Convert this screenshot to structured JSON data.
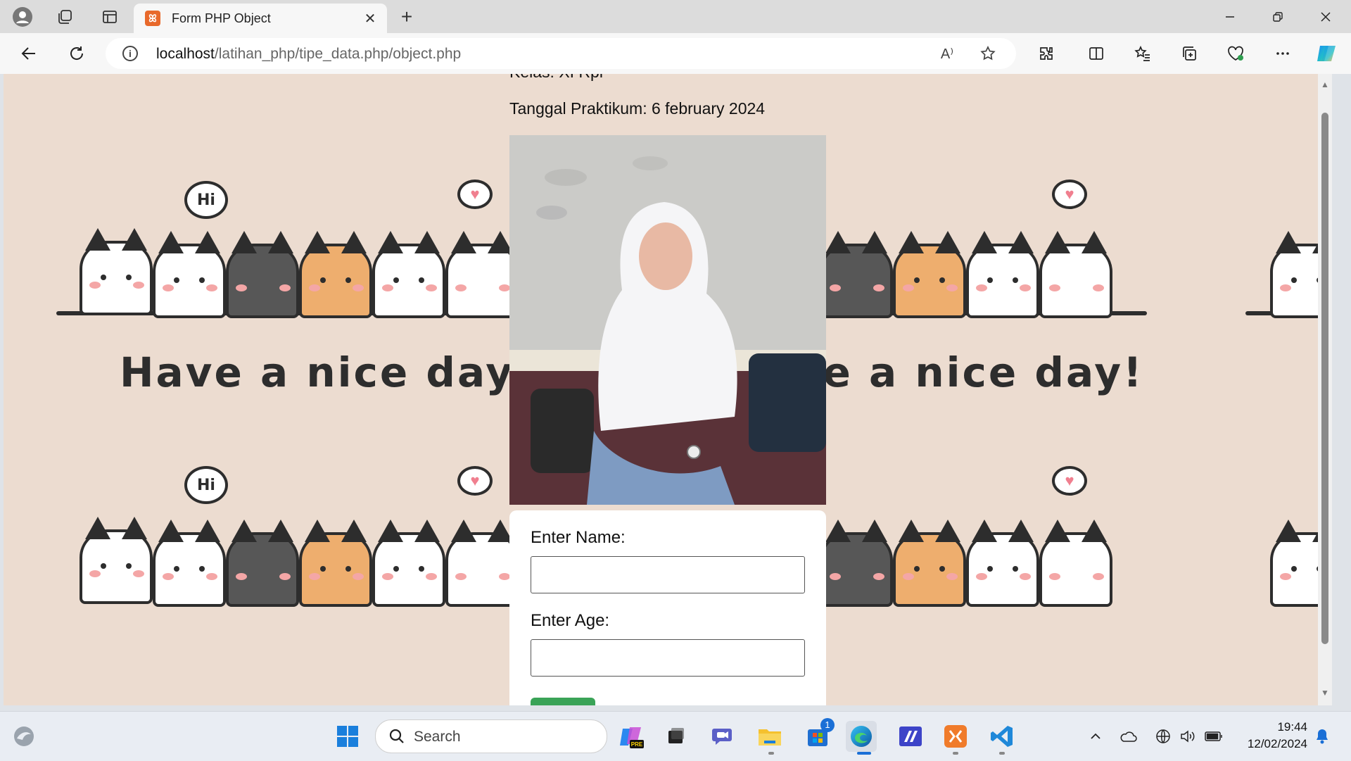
{
  "browser": {
    "tab_title": "Form PHP Object",
    "new_tab_symbol": "+",
    "close_symbol": "✕",
    "url_host": "localhost",
    "url_path": "/latihan_php/tipe_data.php/object.php",
    "read_aloud_label": "A⁾"
  },
  "page": {
    "kelas_text": "Kelas: XI Rpl",
    "tanggal_text": "Tanggal Praktikum: 6 february 2024",
    "background_text": "Have a nice day!",
    "bubble_hi": "Hi",
    "form": {
      "name_label": "Enter Name:",
      "name_value": "",
      "age_label": "Enter Age:",
      "age_value": ""
    }
  },
  "taskbar": {
    "search_placeholder": "Search",
    "store_badge": "1",
    "time": "19:44",
    "date": "12/02/2024"
  },
  "colors": {
    "page_background": "#ecdcd0",
    "submit_button": "#3aa357",
    "tab_favicon": "#e8692b"
  }
}
